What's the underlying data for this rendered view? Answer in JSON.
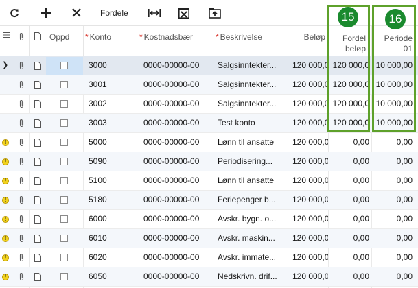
{
  "toolbar": {
    "fordele_label": "Fordele",
    "icons": [
      "refresh-icon",
      "plus-icon",
      "close-icon",
      "fit-columns-icon",
      "excel-export-icon",
      "upload-icon"
    ]
  },
  "columns": {
    "oppd": "Oppd",
    "konto": "Konto",
    "kostnadsbaer": "Kostnadsbær",
    "beskrivelse": "Beskrivelse",
    "belop": "Beløp",
    "fordel_line1": "Fordel",
    "fordel_line2": "beløp",
    "periode_line1": "Periode",
    "periode_line2": "01"
  },
  "rows": [
    {
      "status": "selected",
      "konto": "3000",
      "kostnadsbaer": "0000-00000-00",
      "beskrivelse": "Salgsinntekter...",
      "belop": "120 000,0",
      "fordel": "120 000,0",
      "periode": "10 000,00"
    },
    {
      "status": "none",
      "konto": "3001",
      "kostnadsbaer": "0000-00000-00",
      "beskrivelse": "Salgsinntekter...",
      "belop": "120 000,0",
      "fordel": "120 000,0",
      "periode": "10 000,00"
    },
    {
      "status": "none",
      "konto": "3002",
      "kostnadsbaer": "0000-00000-00",
      "beskrivelse": "Salgsinntekter...",
      "belop": "120 000,0",
      "fordel": "120 000,0",
      "periode": "10 000,00"
    },
    {
      "status": "none",
      "konto": "3003",
      "kostnadsbaer": "0000-00000-00",
      "beskrivelse": "Test konto",
      "belop": "120 000,0",
      "fordel": "120 000,0",
      "periode": "10 000,00"
    },
    {
      "status": "warning",
      "konto": "5000",
      "kostnadsbaer": "0000-00000-00",
      "beskrivelse": "Lønn til ansatte",
      "belop": "120 000,0",
      "fordel": "0,00",
      "periode": "0,00"
    },
    {
      "status": "warning",
      "konto": "5090",
      "kostnadsbaer": "0000-00000-00",
      "beskrivelse": "Periodisering...",
      "belop": "120 000,0",
      "fordel": "0,00",
      "periode": "0,00"
    },
    {
      "status": "warning",
      "konto": "5100",
      "kostnadsbaer": "0000-00000-00",
      "beskrivelse": "Lønn til ansatte",
      "belop": "120 000,0",
      "fordel": "0,00",
      "periode": "0,00"
    },
    {
      "status": "warning",
      "konto": "5180",
      "kostnadsbaer": "0000-00000-00",
      "beskrivelse": "Feriepenger b...",
      "belop": "120 000,0",
      "fordel": "0,00",
      "periode": "0,00"
    },
    {
      "status": "warning",
      "konto": "6000",
      "kostnadsbaer": "0000-00000-00",
      "beskrivelse": "Avskr. bygn. o...",
      "belop": "120 000,0",
      "fordel": "0,00",
      "periode": "0,00"
    },
    {
      "status": "warning",
      "konto": "6010",
      "kostnadsbaer": "0000-00000-00",
      "beskrivelse": "Avskr. maskin...",
      "belop": "120 000,0",
      "fordel": "0,00",
      "periode": "0,00"
    },
    {
      "status": "warning",
      "konto": "6020",
      "kostnadsbaer": "0000-00000-00",
      "beskrivelse": "Avskr. immate...",
      "belop": "120 000,0",
      "fordel": "0,00",
      "periode": "0,00"
    },
    {
      "status": "warning",
      "konto": "6050",
      "kostnadsbaer": "0000-00000-00",
      "beskrivelse": "Nedskrivn. drif...",
      "belop": "120 000,0",
      "fordel": "0,00",
      "periode": "0,00"
    }
  ],
  "annotations": {
    "badge_fordel": "15",
    "badge_periode": "16"
  },
  "colors": {
    "accent_green": "#5ea12b",
    "badge_green": "#1a8a2e",
    "selected_row": "#e2e8f0",
    "warning_yellow": "#f2d21d",
    "required_red": "#d9342b"
  }
}
